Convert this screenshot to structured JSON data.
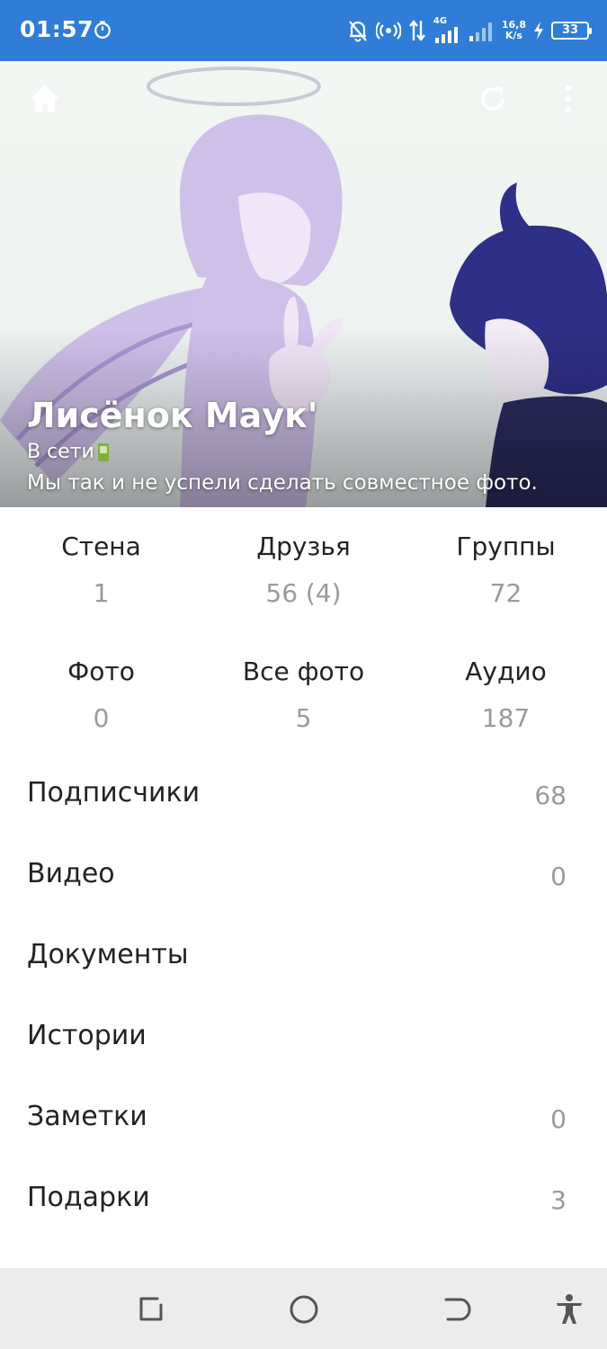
{
  "status_bar": {
    "time": "01:57",
    "network": "4G",
    "speed_value": "16,8",
    "speed_unit": "K/s",
    "battery": "33"
  },
  "profile": {
    "name": "Лисёнок Маук'",
    "online_status": "В сети",
    "about": "Мы так и не успели сделать совместное фото."
  },
  "counters_row1": [
    {
      "label": "Стена",
      "value": "1"
    },
    {
      "label": "Друзья",
      "value": "56 (4)"
    },
    {
      "label": "Группы",
      "value": "72"
    }
  ],
  "counters_row2": [
    {
      "label": "Фото",
      "value": "0"
    },
    {
      "label": "Все фото",
      "value": "5"
    },
    {
      "label": "Аудио",
      "value": "187"
    }
  ],
  "menu": [
    {
      "label": "Подписчики",
      "value": "68"
    },
    {
      "label": "Видео",
      "value": "0"
    },
    {
      "label": "Документы",
      "value": ""
    },
    {
      "label": "Истории",
      "value": ""
    },
    {
      "label": "Заметки",
      "value": "0"
    },
    {
      "label": "Подарки",
      "value": "3"
    }
  ],
  "colors": {
    "status_bar": "#2f7dd6",
    "count_text": "#9a9a9a",
    "nav_bar": "#ececec"
  }
}
